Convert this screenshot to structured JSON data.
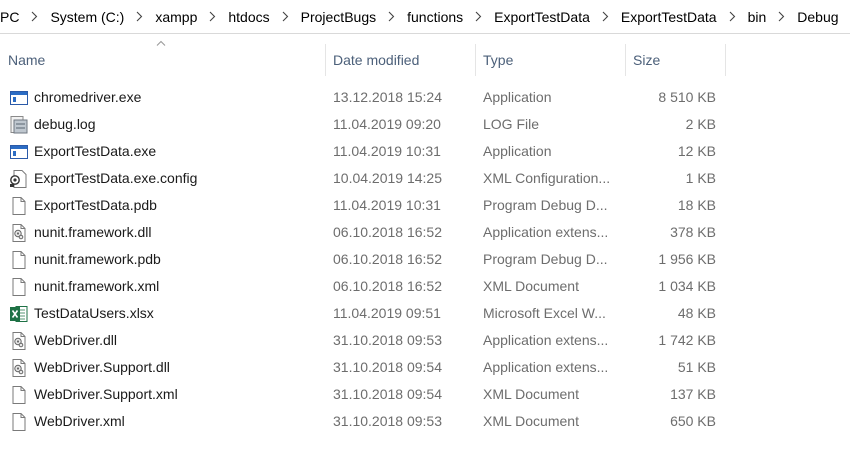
{
  "breadcrumb": [
    "PC",
    "System (C:)",
    "xampp",
    "htdocs",
    "ProjectBugs",
    "functions",
    "ExportTestData",
    "ExportTestData",
    "bin",
    "Debug"
  ],
  "columns": {
    "name": "Name",
    "date": "Date modified",
    "type": "Type",
    "size": "Size"
  },
  "files": [
    {
      "name": "chromedriver.exe",
      "date": "13.12.2018 15:24",
      "type": "Application",
      "size": "8 510 KB",
      "icon": "exe-icon"
    },
    {
      "name": "debug.log",
      "date": "11.04.2019 09:20",
      "type": "LOG File",
      "size": "2 KB",
      "icon": "log-icon"
    },
    {
      "name": "ExportTestData.exe",
      "date": "11.04.2019 10:31",
      "type": "Application",
      "size": "12 KB",
      "icon": "exe-icon"
    },
    {
      "name": "ExportTestData.exe.config",
      "date": "10.04.2019 14:25",
      "type": "XML Configuration...",
      "size": "1 KB",
      "icon": "config-icon"
    },
    {
      "name": "ExportTestData.pdb",
      "date": "11.04.2019 10:31",
      "type": "Program Debug D...",
      "size": "18 KB",
      "icon": "file-icon"
    },
    {
      "name": "nunit.framework.dll",
      "date": "06.10.2018 16:52",
      "type": "Application extens...",
      "size": "378 KB",
      "icon": "dll-icon"
    },
    {
      "name": "nunit.framework.pdb",
      "date": "06.10.2018 16:52",
      "type": "Program Debug D...",
      "size": "1 956 KB",
      "icon": "file-icon"
    },
    {
      "name": "nunit.framework.xml",
      "date": "06.10.2018 16:52",
      "type": "XML Document",
      "size": "1 034 KB",
      "icon": "file-icon"
    },
    {
      "name": "TestDataUsers.xlsx",
      "date": "11.04.2019 09:51",
      "type": "Microsoft Excel W...",
      "size": "48 KB",
      "icon": "excel-icon"
    },
    {
      "name": "WebDriver.dll",
      "date": "31.10.2018 09:53",
      "type": "Application extens...",
      "size": "1 742 KB",
      "icon": "dll-icon"
    },
    {
      "name": "WebDriver.Support.dll",
      "date": "31.10.2018 09:54",
      "type": "Application extens...",
      "size": "51 KB",
      "icon": "dll-icon"
    },
    {
      "name": "WebDriver.Support.xml",
      "date": "31.10.2018 09:54",
      "type": "XML Document",
      "size": "137 KB",
      "icon": "file-icon"
    },
    {
      "name": "WebDriver.xml",
      "date": "31.10.2018 09:53",
      "type": "XML Document",
      "size": "650 KB",
      "icon": "file-icon"
    }
  ]
}
